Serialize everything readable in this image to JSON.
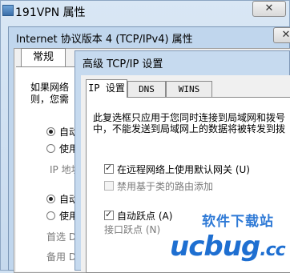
{
  "win_vpn": {
    "title": "191VPN 属性",
    "close": "✕"
  },
  "win_ipv4": {
    "title": "Internet 协议版本 4 (TCP/IPv4) 属性",
    "close": "✕",
    "tab": "常规",
    "intro_line1": "如果网络",
    "intro_line2": "则，您需",
    "radio_auto_ip": "自动",
    "radio_use_ip": "使用",
    "ip_label": "IP 地址",
    "radio_auto_dns": "自动",
    "radio_use_dns": "使用",
    "dns_preferred": "首选 D",
    "dns_alternate": "备用 D"
  },
  "win_advanced": {
    "title": "高级 TCP/IP 设置",
    "tabs": [
      {
        "label": "IP 设置",
        "active": true
      },
      {
        "label": "DNS",
        "active": false
      },
      {
        "label": "WINS",
        "active": false
      }
    ],
    "desc_line1": "此复选框只应用于您同时连接到局域网和拨号",
    "desc_line2": "中，不能发送到局域网上的数据将被转发到拨",
    "cb_default_gateway": {
      "label": "在远程网络上使用默认网关 (U)",
      "checked": true
    },
    "cb_class_route": {
      "label": "禁用基于类的路由添加",
      "checked": false
    },
    "cb_auto_metric": {
      "label": "自动跃点 (A)",
      "checked": true
    },
    "interface_metric_label": "接口跃点 (N)"
  },
  "watermark": {
    "site_cn": "软件下载站",
    "logo_main": "ucbug",
    "logo_tld": ".cc"
  }
}
